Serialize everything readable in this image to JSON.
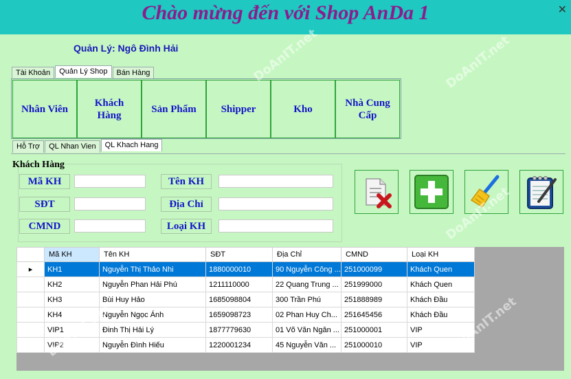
{
  "title": "Chào mừng đến với Shop AnDa 1",
  "manager": "Quản Lý: Ngô Đình Hải",
  "main_tabs": [
    "Tài Khoản",
    "Quản Lý Shop",
    "Bán Hàng"
  ],
  "tiles": [
    "Nhân Viên",
    "Khách Hàng",
    "Sản Phẩm",
    "Shipper",
    "Kho",
    "Nhà Cung Cấp"
  ],
  "sub_tabs": [
    "Hỗ Trợ",
    "QL Nhan Vien",
    "QL Khach Hang"
  ],
  "group_title": "Khách Hàng",
  "fields": {
    "ma_kh": "Mã KH",
    "sdt": "SĐT",
    "cmnd": "CMND",
    "ten_kh": "Tên KH",
    "dia_chi": "Địa Chỉ",
    "loai_kh": "Loại KH"
  },
  "actions": [
    "delete-icon",
    "add-icon",
    "clear-icon",
    "edit-icon"
  ],
  "grid": {
    "columns": [
      "Mã KH",
      "Tên KH",
      "SĐT",
      "Địa Chỉ",
      "CMND",
      "Loại KH"
    ],
    "rows": [
      [
        "KH1",
        "Nguyễn Thị Thảo Nhi",
        "1880000010",
        "90 Nguyễn Công ...",
        "251000099",
        "Khách Quen"
      ],
      [
        "KH2",
        "Nguyễn Phan Hải Phú",
        "1211110000",
        "22 Quang Trung ...",
        "251999000",
        "Khách Quen"
      ],
      [
        "KH3",
        "Bùi Huy Hảo",
        "1685098804",
        "300 Trần Phú",
        "251888989",
        "Khách Đầu"
      ],
      [
        "KH4",
        "Nguyễn Ngọc Ánh",
        "1659098723",
        "02 Phan Huy Ch...",
        "251645456",
        "Khách Đầu"
      ],
      [
        "VIP1",
        "Đinh Thị Hải Lý",
        "1877779630",
        "01 Võ Văn Ngân ...",
        "251000001",
        "VIP"
      ],
      [
        "VIP2",
        "Nguyễn Đình Hiếu",
        "1220001234",
        "45 Nguyễn Văn ...",
        "251000010",
        "VIP"
      ]
    ]
  },
  "colors": {
    "window_bg": "#1fc8c0",
    "panel_bg": "#c6f7c2",
    "title": "#8b1c8e",
    "label_blue": "#1414c8",
    "selection": "#0078d7"
  },
  "watermark": "DoAnIT.net"
}
